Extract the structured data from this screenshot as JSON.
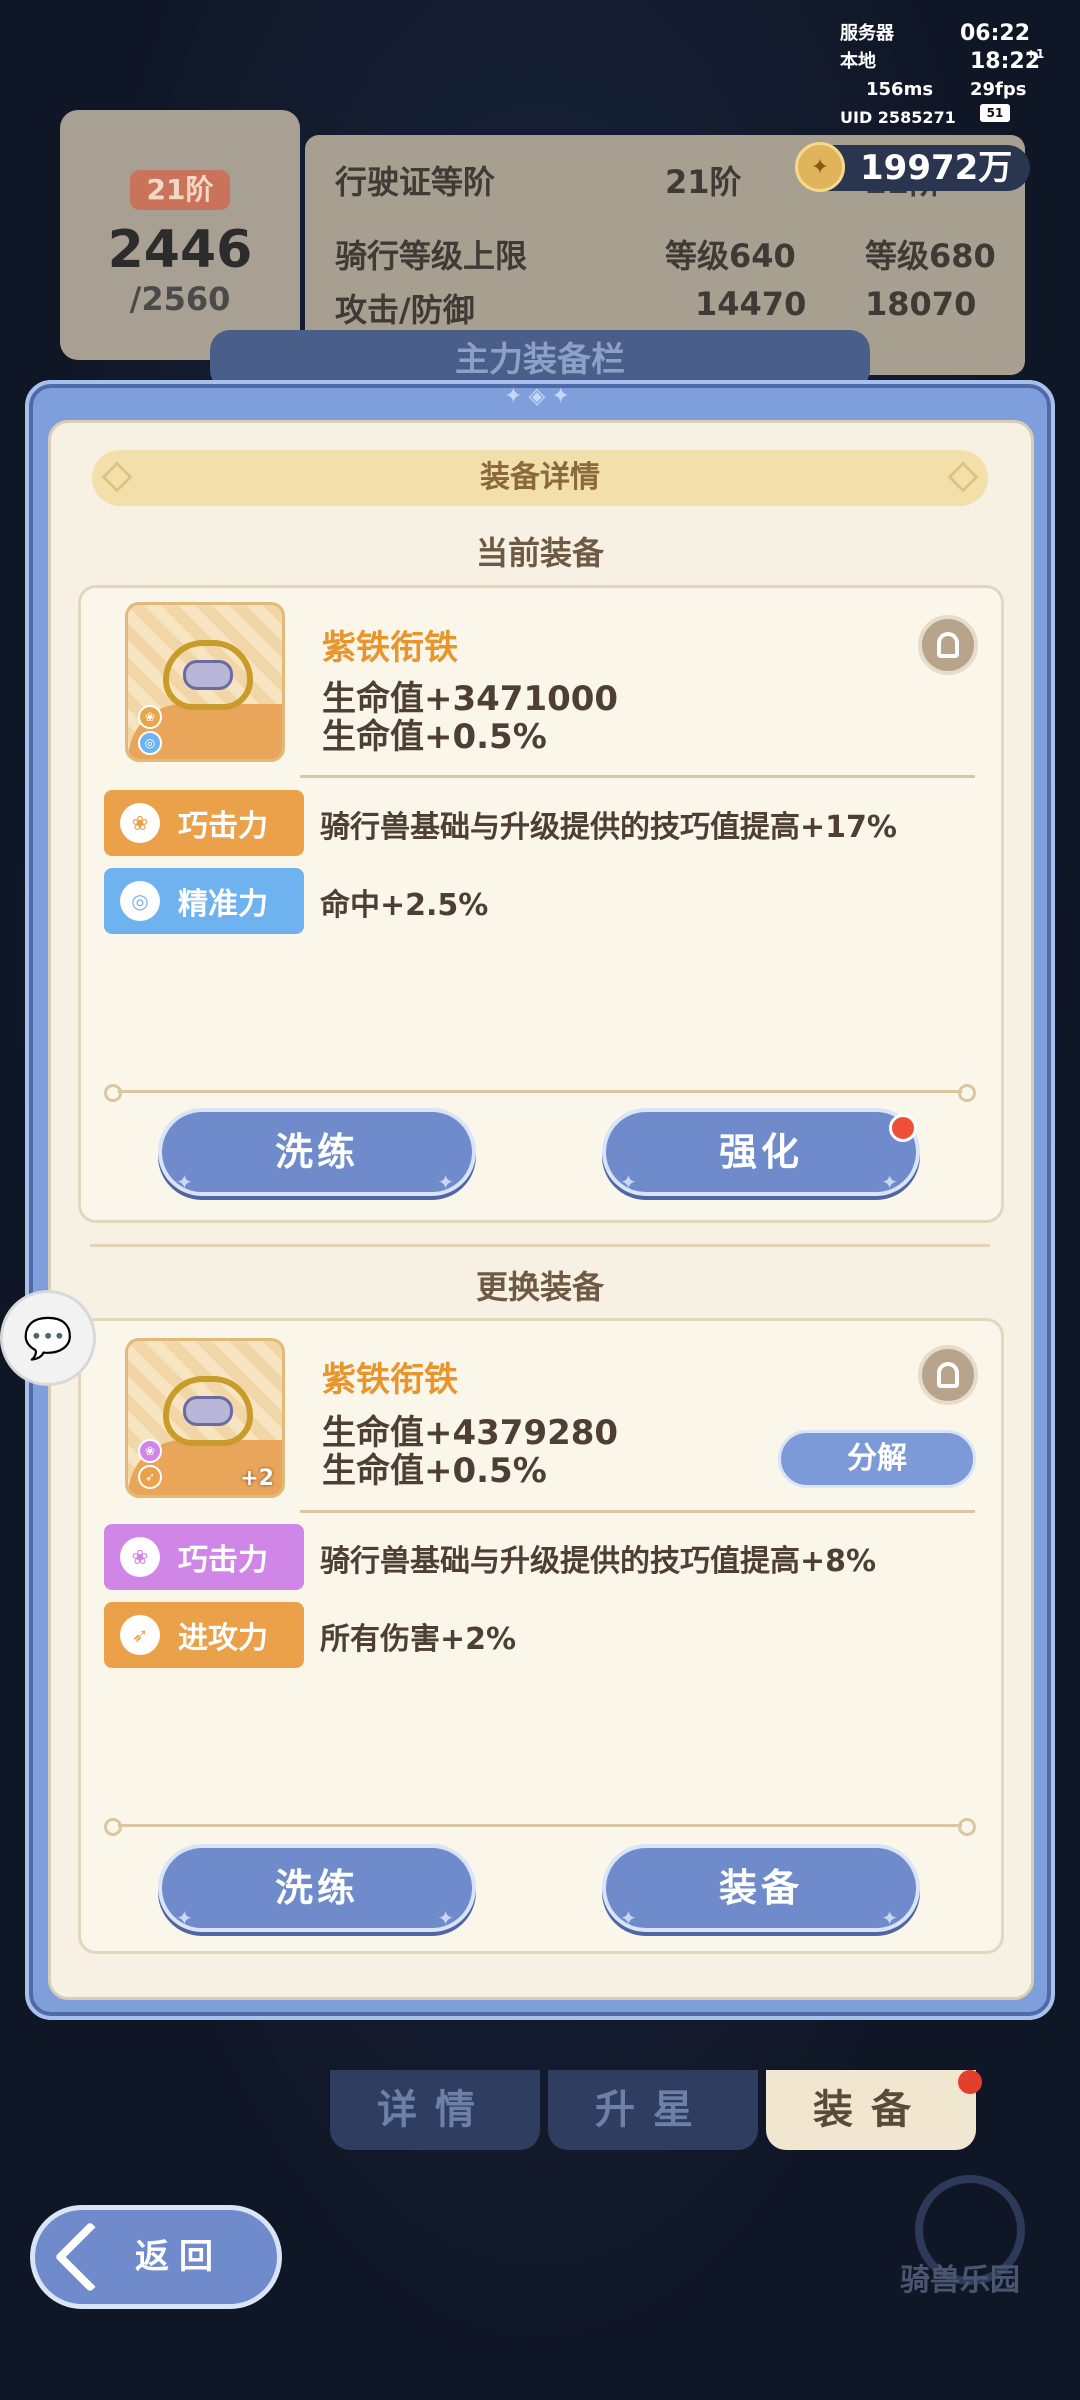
{
  "status_bar": {
    "server_label": "服务器",
    "server_time": "06:22",
    "local_label": "本地",
    "local_time": "18:22",
    "day_offset": "+1",
    "ping": "156ms",
    "fps": "29fps",
    "uid": "UID 2585271",
    "battery": "51"
  },
  "currency": {
    "value": "19972万",
    "icon": "coin-icon"
  },
  "license_card": {
    "rank_tag": "21阶",
    "score": "2446",
    "score_max": "/2560"
  },
  "license_info": {
    "rows": [
      {
        "label": "行驶证等阶",
        "current": "21阶",
        "next": "22阶"
      },
      {
        "label": "骑行等级上限",
        "current": "等级640",
        "next": "等级680"
      },
      {
        "label": "攻击/防御",
        "current": "14470",
        "next": "18070"
      }
    ],
    "equipment_bar_title": "主力装备栏"
  },
  "modal": {
    "title": "装备详情",
    "current_section": "当前装备",
    "replace_section": "更换装备",
    "current_item": {
      "name": "紫铁衔铁",
      "stat1": "生命值+3471000",
      "stat2": "生命值+0.5%",
      "attrs": [
        {
          "tag": "巧击力",
          "desc": "骑行兽基础与升级提供的技巧值提高+17%",
          "color": "#eba04a"
        },
        {
          "tag": "精准力",
          "desc": "命中+2.5%",
          "color": "#6fb2f0"
        }
      ],
      "btn_refine": "洗练",
      "btn_enhance": "强化"
    },
    "replace_item": {
      "name": "紫铁衔铁",
      "plus": "+2",
      "stat1": "生命值+4379280",
      "stat2": "生命值+0.5%",
      "btn_decompose": "分解",
      "attrs": [
        {
          "tag": "巧击力",
          "desc": "骑行兽基础与升级提供的技巧值提高+8%",
          "color": "#cf86e6"
        },
        {
          "tag": "进攻力",
          "desc": "所有伤害+2%",
          "color": "#eba04a"
        }
      ],
      "btn_refine": "洗练",
      "btn_equip": "装备"
    }
  },
  "tabs": [
    {
      "label": "详情"
    },
    {
      "label": "升星"
    },
    {
      "label": "装备"
    }
  ],
  "back_label": "返回",
  "logo": "骑兽乐园"
}
